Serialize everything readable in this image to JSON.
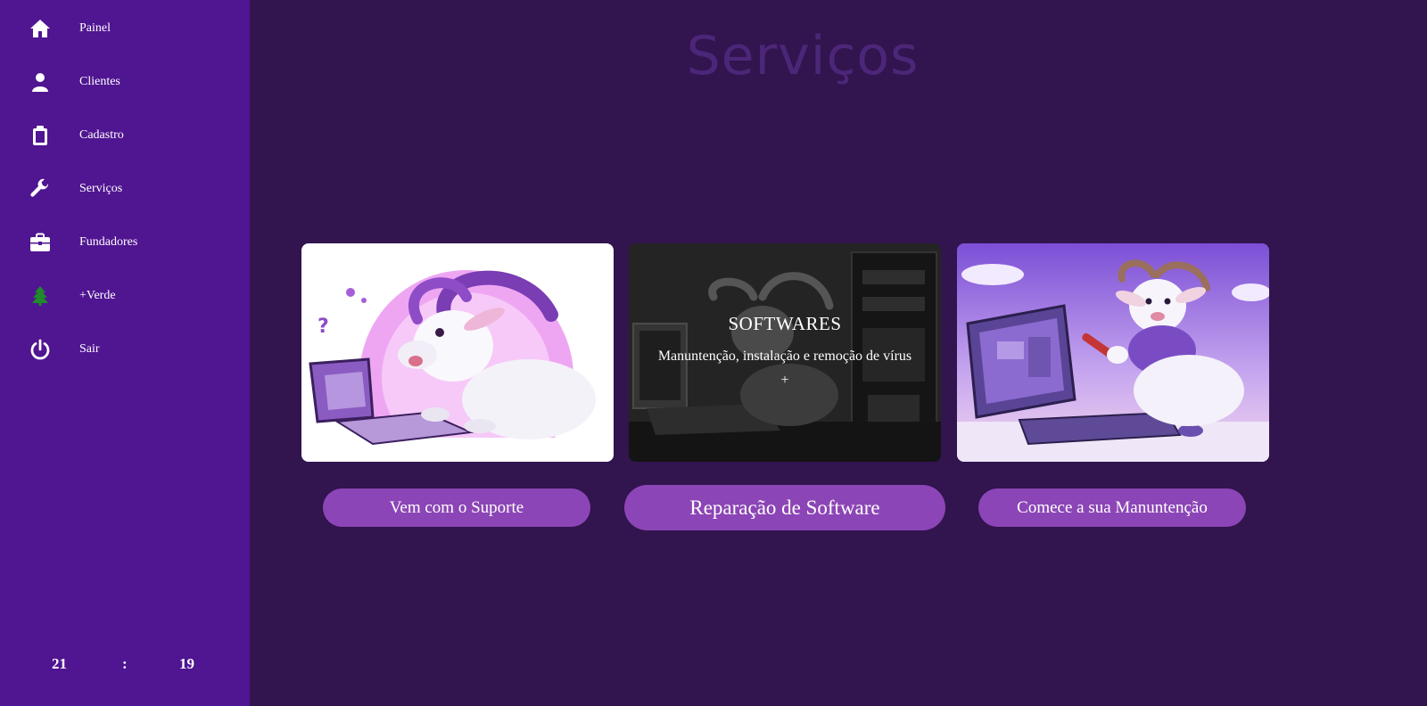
{
  "sidebar": {
    "items": [
      {
        "icon": "home-icon",
        "label": "Painel"
      },
      {
        "icon": "user-icon",
        "label": "Clientes"
      },
      {
        "icon": "clipboard-icon",
        "label": "Cadastro"
      },
      {
        "icon": "wrench-icon",
        "label": "Serviços"
      },
      {
        "icon": "briefcase-icon",
        "label": "Fundadores"
      },
      {
        "icon": "tree-icon",
        "label": "+Verde"
      },
      {
        "icon": "power-icon",
        "label": "Sair"
      }
    ],
    "clock": {
      "hours": "21",
      "separator": ":",
      "minutes": "19"
    }
  },
  "main": {
    "title": "Serviços",
    "cards": [
      {
        "image": "goat-using-laptop-illustration",
        "button": "Vem com o Suporte"
      },
      {
        "image": "goat-at-computer-dark-illustration",
        "overlay_title": "SOFTWARES",
        "overlay_text": "Manuntenção, instalação e remoção de vírus +",
        "button": "Reparação de Software"
      },
      {
        "image": "goat-repairing-computer-illustration",
        "button": "Comece a sua Manuntenção"
      }
    ]
  },
  "colors": {
    "sidebar_bg": "#501591",
    "main_bg": "#32144f",
    "button_bg": "#8c45b6",
    "title_color": "#4c2678",
    "tree_icon": "#1f8a2a"
  }
}
